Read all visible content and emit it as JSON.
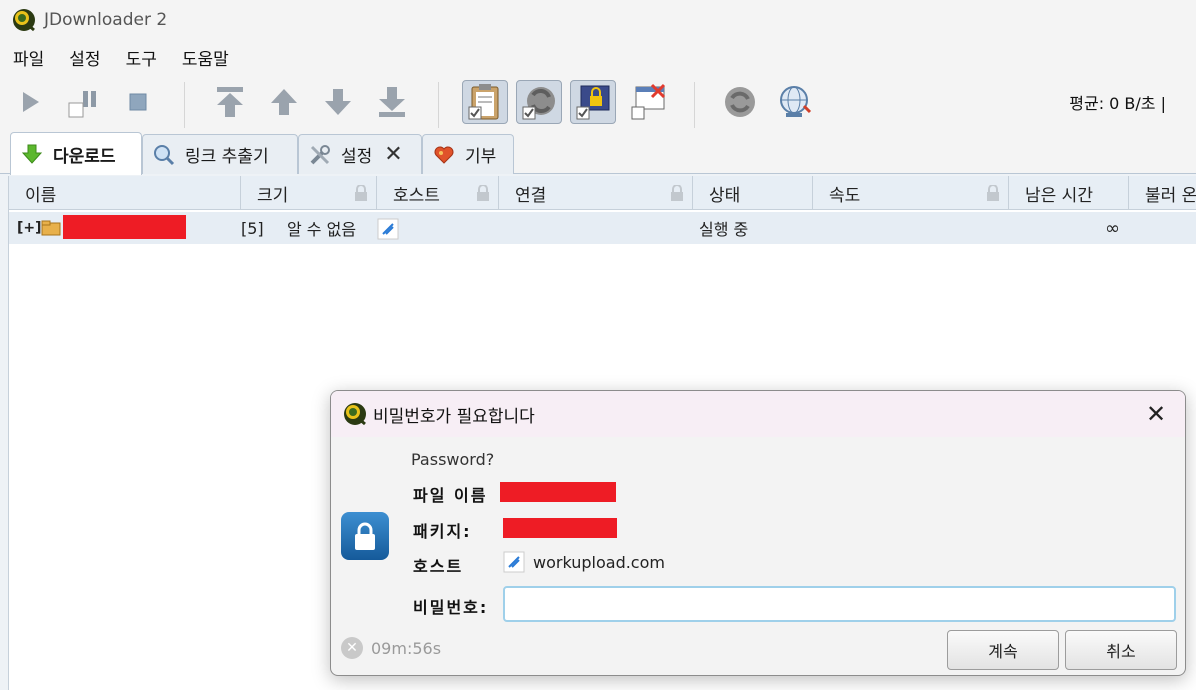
{
  "window": {
    "title": "JDownloader 2"
  },
  "menu": [
    "파일",
    "설정",
    "도구",
    "도움말"
  ],
  "toolbar": {
    "speed": "평균: 0 B/초 |"
  },
  "tabs": [
    {
      "label": "다운로드",
      "icon": "download-arrow-icon"
    },
    {
      "label": "링크 추출기",
      "icon": "magnifier-icon"
    },
    {
      "label": "설정",
      "icon": "tools-icon"
    },
    {
      "label": "기부",
      "icon": "heart-icon"
    }
  ],
  "table": {
    "columns": [
      "이름",
      "크기",
      "호스트",
      "연결",
      "상태",
      "속도",
      "남은 시간",
      "불러 온"
    ],
    "rows": [
      {
        "expand": "[+]",
        "size": "[5]",
        "host": "알 수 없음",
        "status": "실행 중",
        "eta": "∞"
      }
    ]
  },
  "dialog": {
    "title": "비밀번호가 필요합니다",
    "question": "Password?",
    "filename_label": "파일 이름",
    "package_label": "패키지:",
    "host_label": "호스트",
    "host_value": "workupload.com",
    "password_label": "비밀번호:",
    "password_value": "",
    "timer": "09m:56s",
    "continue_label": "계속",
    "cancel_label": "취소"
  },
  "colors": {
    "redaction": "#ee1c25",
    "accent": "#1f6fb5"
  }
}
